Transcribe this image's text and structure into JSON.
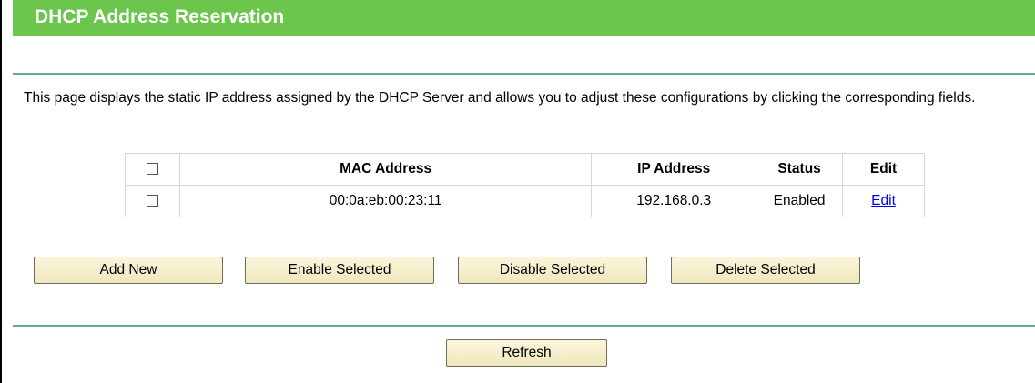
{
  "header": {
    "title": "DHCP Address Reservation"
  },
  "description": "This page displays the static IP address assigned by the DHCP Server and allows you to adjust these configurations by clicking the corresponding fields.",
  "table": {
    "columns": [
      "MAC Address",
      "IP Address",
      "Status",
      "Edit"
    ],
    "rows": [
      {
        "mac": "00:0a:eb:00:23:11",
        "ip": "192.168.0.3",
        "status": "Enabled",
        "edit": "Edit",
        "selected": false
      }
    ],
    "select_all": false
  },
  "buttons": {
    "add_new": "Add New",
    "enable_selected": "Enable Selected",
    "disable_selected": "Disable Selected",
    "delete_selected": "Delete Selected",
    "refresh": "Refresh"
  },
  "colors": {
    "title_bar": "#6cc64d",
    "divider": "#5fae8a",
    "link": "#0000ee",
    "button_bg": "#f5efcc"
  }
}
